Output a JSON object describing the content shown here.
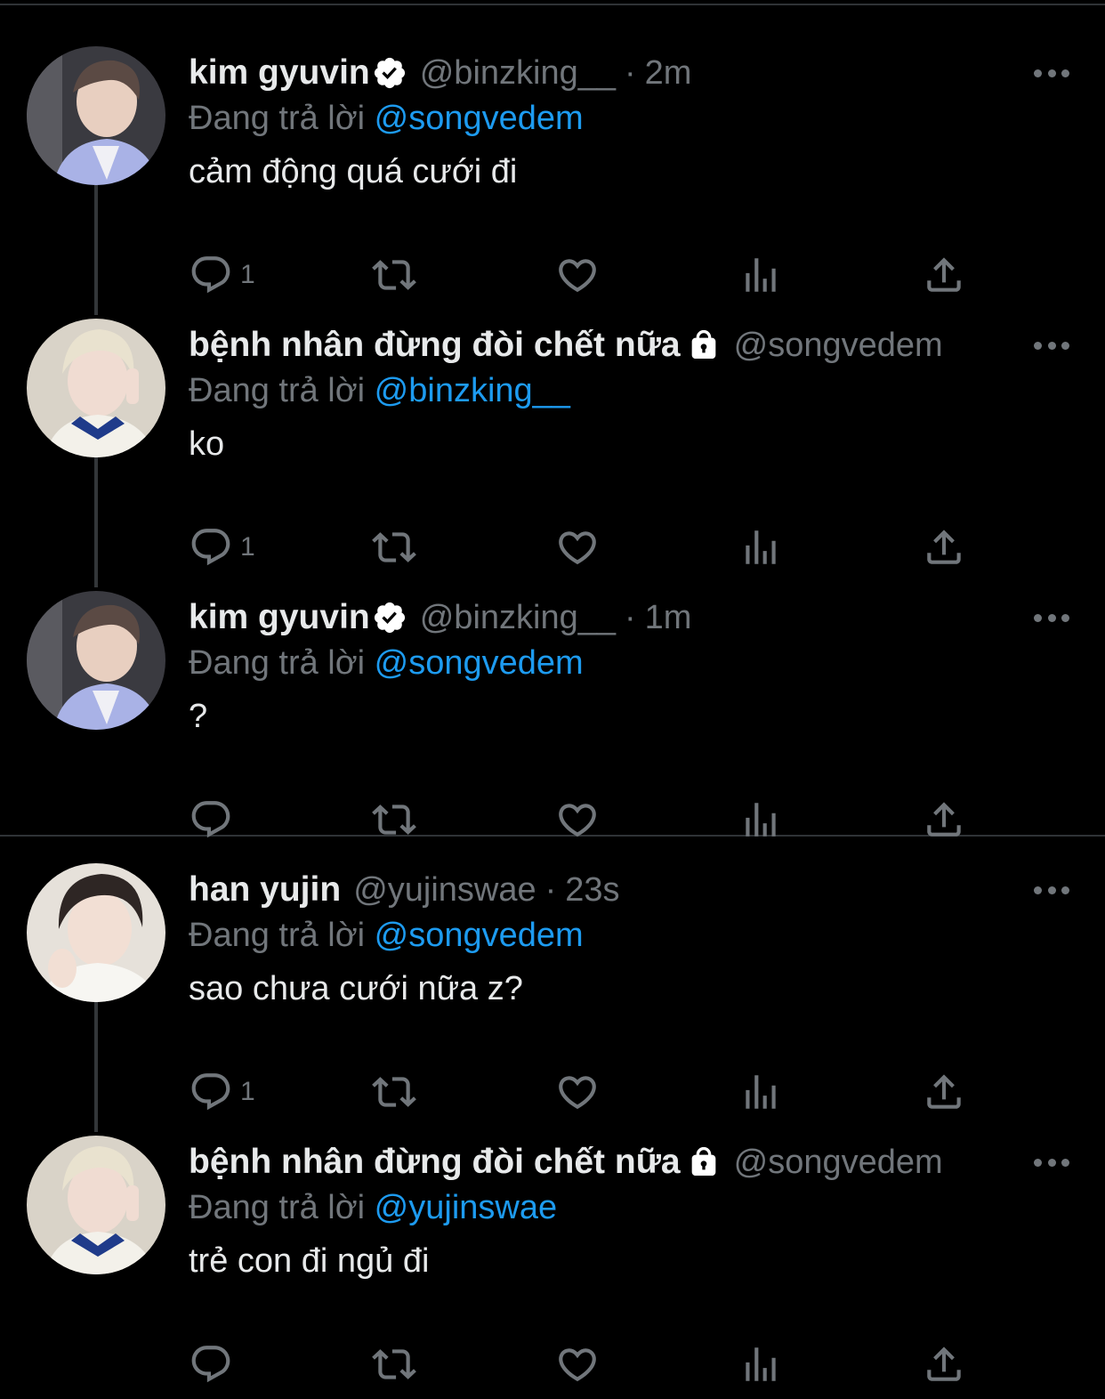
{
  "colors": {
    "background": "#000000",
    "text": "#e7e9ea",
    "muted": "#71767b",
    "link": "#1d9bf0",
    "divider": "#2f3336"
  },
  "icons": {
    "verified": "verified-badge-icon",
    "lock": "lock-icon",
    "more": "more-icon",
    "reply": "reply-icon",
    "retweet": "retweet-icon",
    "like": "like-icon",
    "views": "views-icon",
    "share": "share-icon"
  },
  "tweets": [
    {
      "name": "kim gyuvin",
      "handle": "@binzking__",
      "sep": "·",
      "time": "2m",
      "reply_label": "Đang trả lời",
      "reply_to": "@songvedem",
      "text": "cảm động quá cưới đi",
      "reply_count": "1"
    },
    {
      "name": "bệnh nhân đừng đòi chết nữa",
      "handle": "@songvedem",
      "reply_label": "Đang trả lời",
      "reply_to": "@binzking__",
      "text": "ko",
      "reply_count": "1"
    },
    {
      "name": "kim gyuvin",
      "handle": "@binzking__",
      "sep": "·",
      "time": "1m",
      "reply_label": "Đang trả lời",
      "reply_to": "@songvedem",
      "text": "?",
      "reply_count": ""
    },
    {
      "name": "han yujin",
      "handle": "@yujinswae",
      "sep": "·",
      "time": "23s",
      "reply_label": "Đang trả lời",
      "reply_to": "@songvedem",
      "text": "sao chưa cưới nữa z?",
      "reply_count": "1"
    },
    {
      "name": "bệnh nhân đừng đòi chết nữa",
      "handle": "@songvedem",
      "reply_label": "Đang trả lời",
      "reply_to": "@yujinswae",
      "text": "trẻ con đi ngủ đi",
      "reply_count": ""
    }
  ]
}
